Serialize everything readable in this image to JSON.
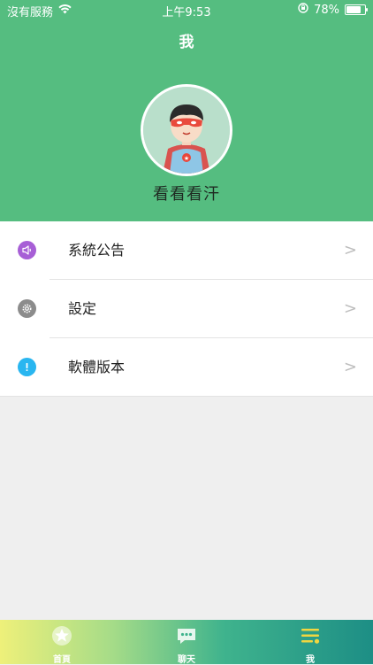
{
  "status_bar": {
    "carrier": "沒有服務",
    "time": "上午9:53",
    "battery": "78%",
    "battery_level": 0.78
  },
  "header": {
    "title": "我",
    "username": "看看看汗",
    "background": "#55bd80"
  },
  "menu": {
    "items": [
      {
        "label": "系統公告",
        "icon": "speaker-icon",
        "color": "#a75fd6"
      },
      {
        "label": "設定",
        "icon": "gear-icon",
        "color": "#8c8c8c"
      },
      {
        "label": "軟體版本",
        "icon": "info-icon",
        "color": "#29b6f0"
      }
    ],
    "chevron": ">"
  },
  "tabbar": {
    "items": [
      {
        "label": "首頁",
        "icon": "star-home-icon"
      },
      {
        "label": "聊天",
        "icon": "chat-bubble-icon"
      },
      {
        "label": "我",
        "icon": "list-menu-icon",
        "selected": true
      }
    ]
  }
}
